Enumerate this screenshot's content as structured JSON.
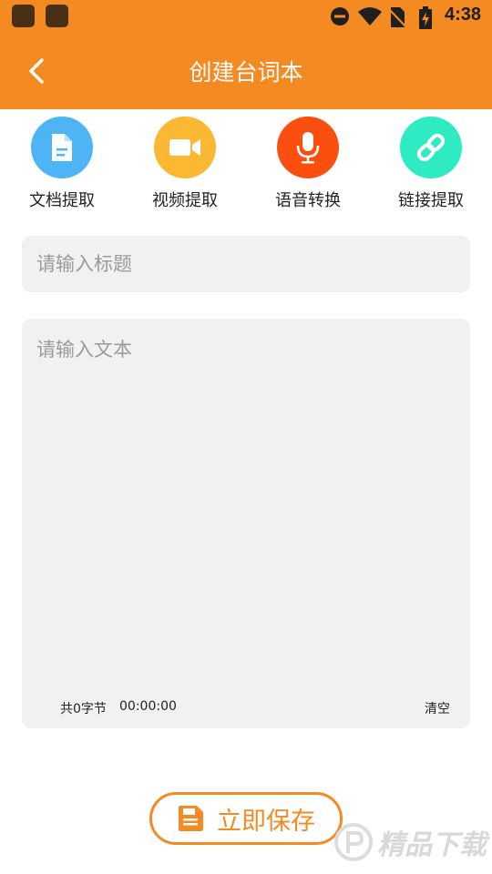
{
  "status_bar": {
    "time": "4:38"
  },
  "app_bar": {
    "title": "创建台词本"
  },
  "tools": [
    {
      "label": "文档提取",
      "color": "#4db5f5",
      "icon": "document-icon"
    },
    {
      "label": "视频提取",
      "color": "#fbb833",
      "icon": "video-camera-icon"
    },
    {
      "label": "语音转换",
      "color": "#fb4f0f",
      "icon": "microphone-icon"
    },
    {
      "label": "链接提取",
      "color": "#2eebc3",
      "icon": "link-icon"
    }
  ],
  "form": {
    "title_placeholder": "请输入标题",
    "text_placeholder": "请输入文本",
    "byte_count": "共0字节",
    "duration": "00:00:00",
    "clear_label": "清空"
  },
  "save_button": {
    "label": "立即保存"
  },
  "watermark": {
    "text": "精品下载",
    "url": "www.jpxz.com"
  },
  "colors": {
    "accent": "#f48a22",
    "input_bg": "#f0f1f3"
  }
}
